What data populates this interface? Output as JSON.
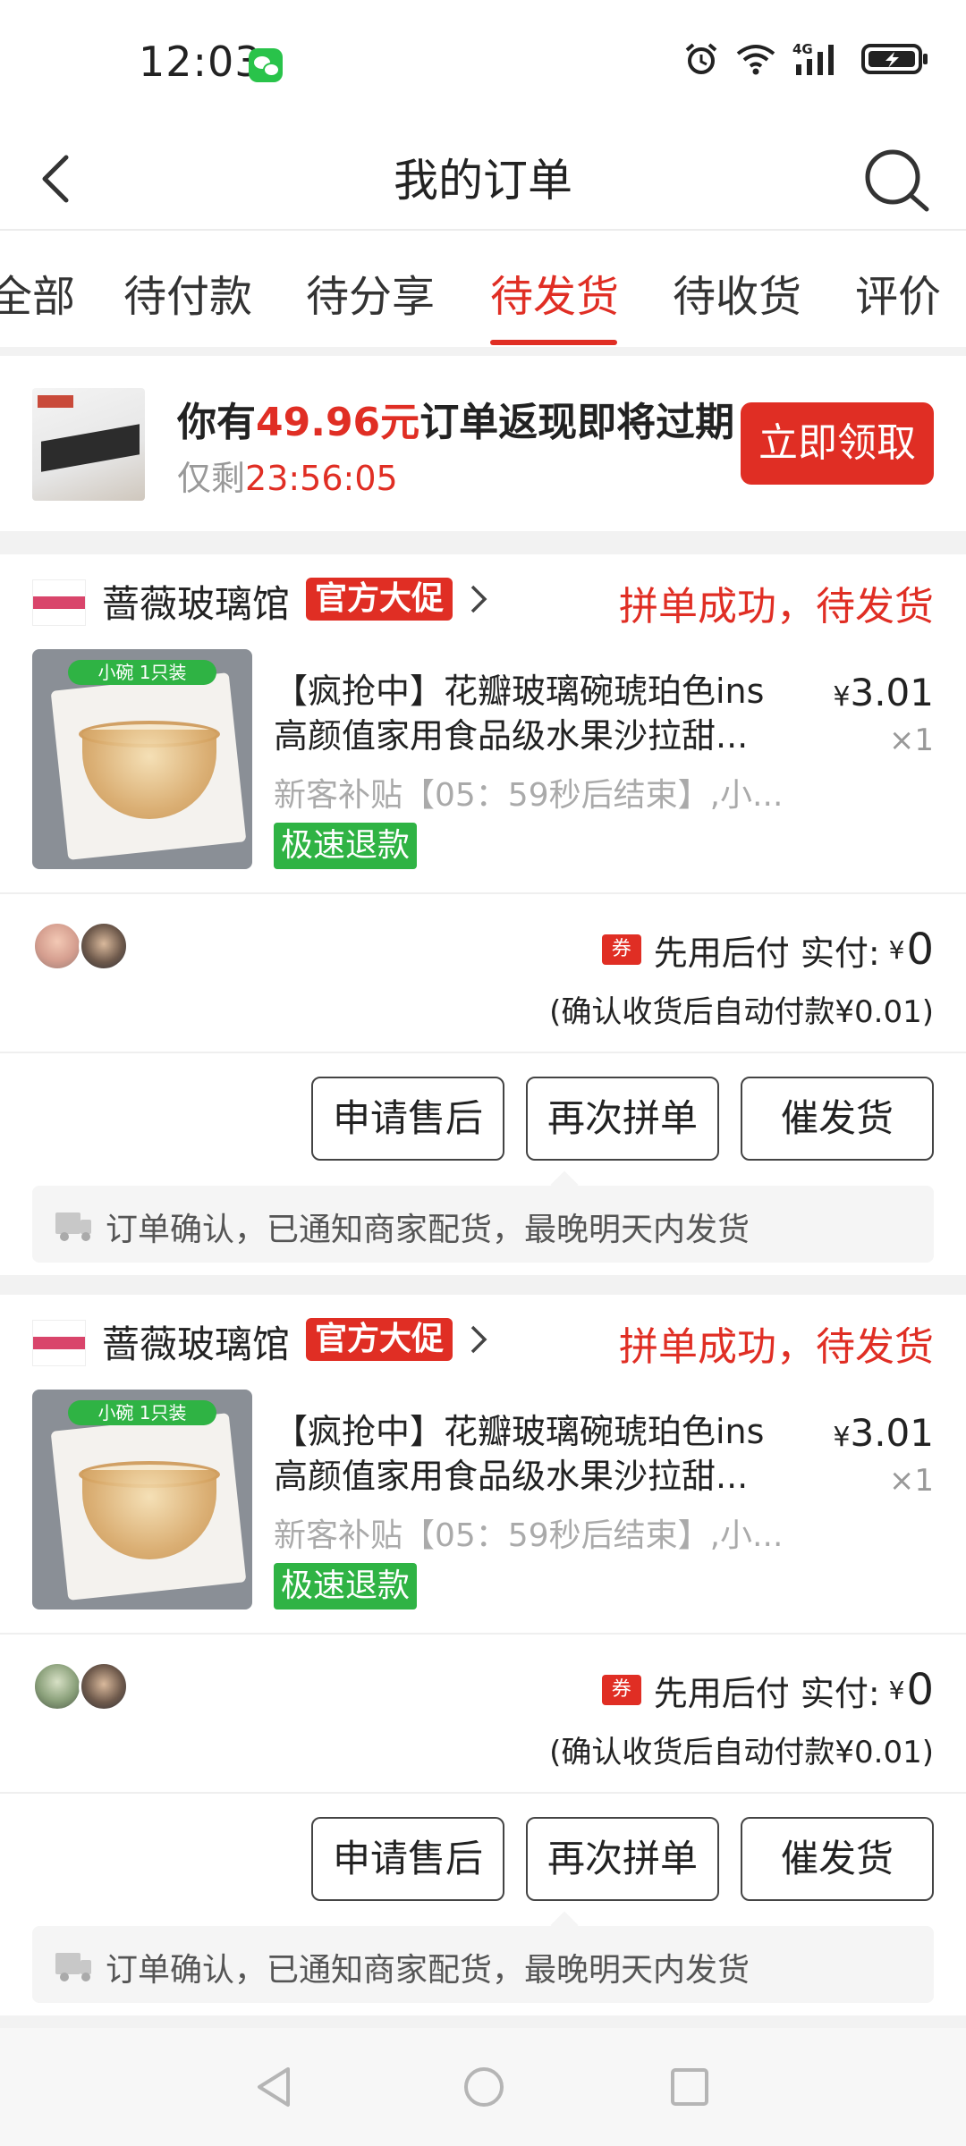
{
  "status_bar": {
    "time": "12:03",
    "network": "4G"
  },
  "header": {
    "title": "我的订单"
  },
  "tabs": [
    {
      "label": "全部",
      "active": false
    },
    {
      "label": "待付款",
      "active": false
    },
    {
      "label": "待分享",
      "active": false
    },
    {
      "label": "待发货",
      "active": true
    },
    {
      "label": "待收货",
      "active": false
    },
    {
      "label": "评价",
      "active": false
    }
  ],
  "banner": {
    "text_prefix": "你有",
    "amount": "49.96元",
    "text_suffix": "订单返现即将过期",
    "sub_prefix": "仅剩",
    "countdown": "23:56:05",
    "button": "立即领取"
  },
  "orders": [
    {
      "shop_name": "蔷薇玻璃馆",
      "promo_badge": "官方大促",
      "status": "拼单成功，待发货",
      "image_label": "小碗 1只装",
      "title_line1": "【疯抢中】花瓣玻璃碗琥珀色ins",
      "title_line2": "高颜值家用食品级水果沙拉甜...",
      "price_symbol": "¥",
      "price": "3.01",
      "quantity": "×1",
      "subsidy": "新客补贴【05：59秒后结束】,小...",
      "refund_tag": "极速退款",
      "coupon": "券",
      "pay_text": "先用后付 实付:",
      "pay_symbol": "¥",
      "pay_amount": "0",
      "auto_pay": "(确认收货后自动付款¥0.01)",
      "buttons": {
        "after_sale": "申请售后",
        "regroup": "再次拼单",
        "urge": "催发货"
      },
      "notice": "订单确认，已通知商家配货，最晚明天内发货"
    },
    {
      "shop_name": "蔷薇玻璃馆",
      "promo_badge": "官方大促",
      "status": "拼单成功，待发货",
      "image_label": "小碗 1只装",
      "title_line1": "【疯抢中】花瓣玻璃碗琥珀色ins",
      "title_line2": "高颜值家用食品级水果沙拉甜...",
      "price_symbol": "¥",
      "price": "3.01",
      "quantity": "×1",
      "subsidy": "新客补贴【05：59秒后结束】,小...",
      "refund_tag": "极速退款",
      "coupon": "券",
      "pay_text": "先用后付 实付:",
      "pay_symbol": "¥",
      "pay_amount": "0",
      "auto_pay": "(确认收货后自动付款¥0.01)",
      "buttons": {
        "after_sale": "申请售后",
        "regroup": "再次拼单",
        "urge": "催发货"
      },
      "notice": "订单确认，已通知商家配货，最晚明天内发货"
    }
  ],
  "colors": {
    "accent": "#e02e24",
    "green": "#2fb344",
    "background_gap": "#f2f2f2"
  }
}
